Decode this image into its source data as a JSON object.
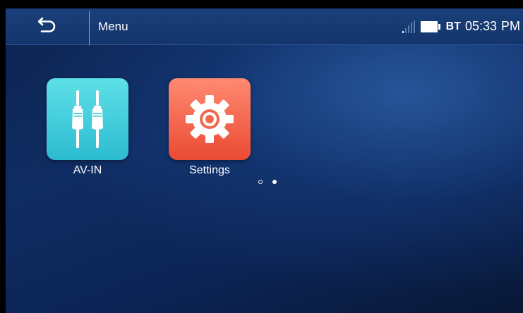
{
  "header": {
    "back_icon": "back-arrow-icon",
    "title": "Menu",
    "status": {
      "signal_icon": "signal-strength-icon",
      "battery_icon": "battery-icon",
      "bt_label": "BT",
      "time": "05:33",
      "ampm": "PM"
    }
  },
  "apps": [
    {
      "label": "AV-IN",
      "icon": "audio-plugs-icon",
      "color": "#2cbcd0"
    },
    {
      "label": "Settings",
      "icon": "gear-icon",
      "color": "#ea4a32"
    }
  ],
  "pager": {
    "page_count": 2,
    "current_page": 2
  },
  "colors": {
    "background": "#0f2c62",
    "header": "#1a3f7a"
  }
}
